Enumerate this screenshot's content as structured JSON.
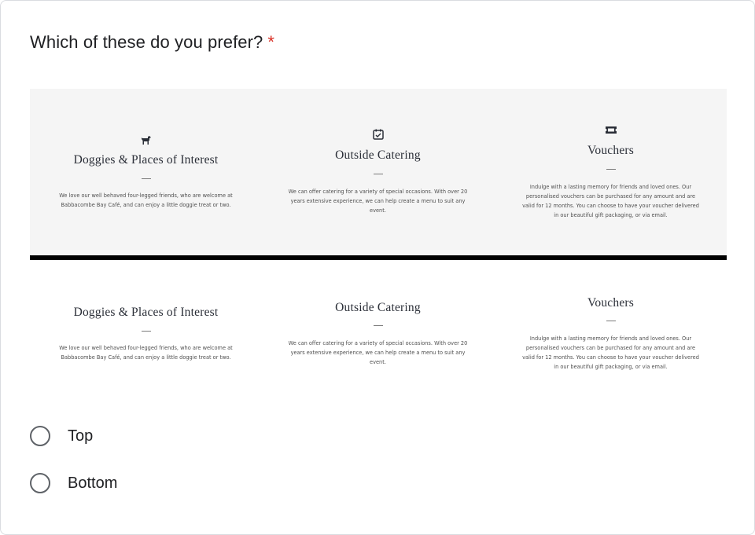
{
  "question": {
    "text": "Which of these do you prefer?",
    "required_mark": "*"
  },
  "image": {
    "top_variant": {
      "columns": [
        {
          "icon": "dog-icon",
          "title": "Doggies & Places of Interest",
          "desc_lines": [
            "We love our well behaved four-legged friends, who are welcome at",
            "Babbacombe Bay Café, and can enjoy a little doggie treat or two."
          ]
        },
        {
          "icon": "calendar-check-icon",
          "title": "Outside Catering",
          "desc_lines": [
            "We can offer catering for a variety of special occasions. With over 20",
            "years extensive experience, we can help create a menu to suit any",
            "event."
          ]
        },
        {
          "icon": "ticket-icon",
          "title": "Vouchers",
          "desc_lines": [
            "Indulge with a lasting memory for friends and loved ones. Our",
            "personalised vouchers can be purchased for any amount and are",
            "valid for 12 months. You can choose to have your voucher delivered",
            "in our beautiful gift packaging, or via email."
          ]
        }
      ]
    },
    "bottom_variant": {
      "columns": [
        {
          "title": "Doggies & Places of Interest",
          "desc_lines": [
            "We love our well behaved four-legged friends, who are welcome at",
            "Babbacombe Bay Café, and can enjoy a little doggie treat or two."
          ]
        },
        {
          "title": "Outside Catering",
          "desc_lines": [
            "We can offer catering for a variety of special occasions. With over 20",
            "years extensive experience, we can help create a menu to suit any",
            "event."
          ]
        },
        {
          "title": "Vouchers",
          "desc_lines": [
            "Indulge with a lasting memory for friends and loved ones. Our",
            "personalised vouchers can be purchased for any amount and are",
            "valid for 12 months. You can choose to have your voucher delivered",
            "in our beautiful gift packaging, or via email."
          ]
        }
      ]
    }
  },
  "options": [
    {
      "label": "Top",
      "selected": false
    },
    {
      "label": "Bottom",
      "selected": false
    }
  ],
  "colors": {
    "required": "#d93025",
    "radio_border": "#5f6368",
    "text": "#202124",
    "image_bg": "#f5f5f5"
  }
}
